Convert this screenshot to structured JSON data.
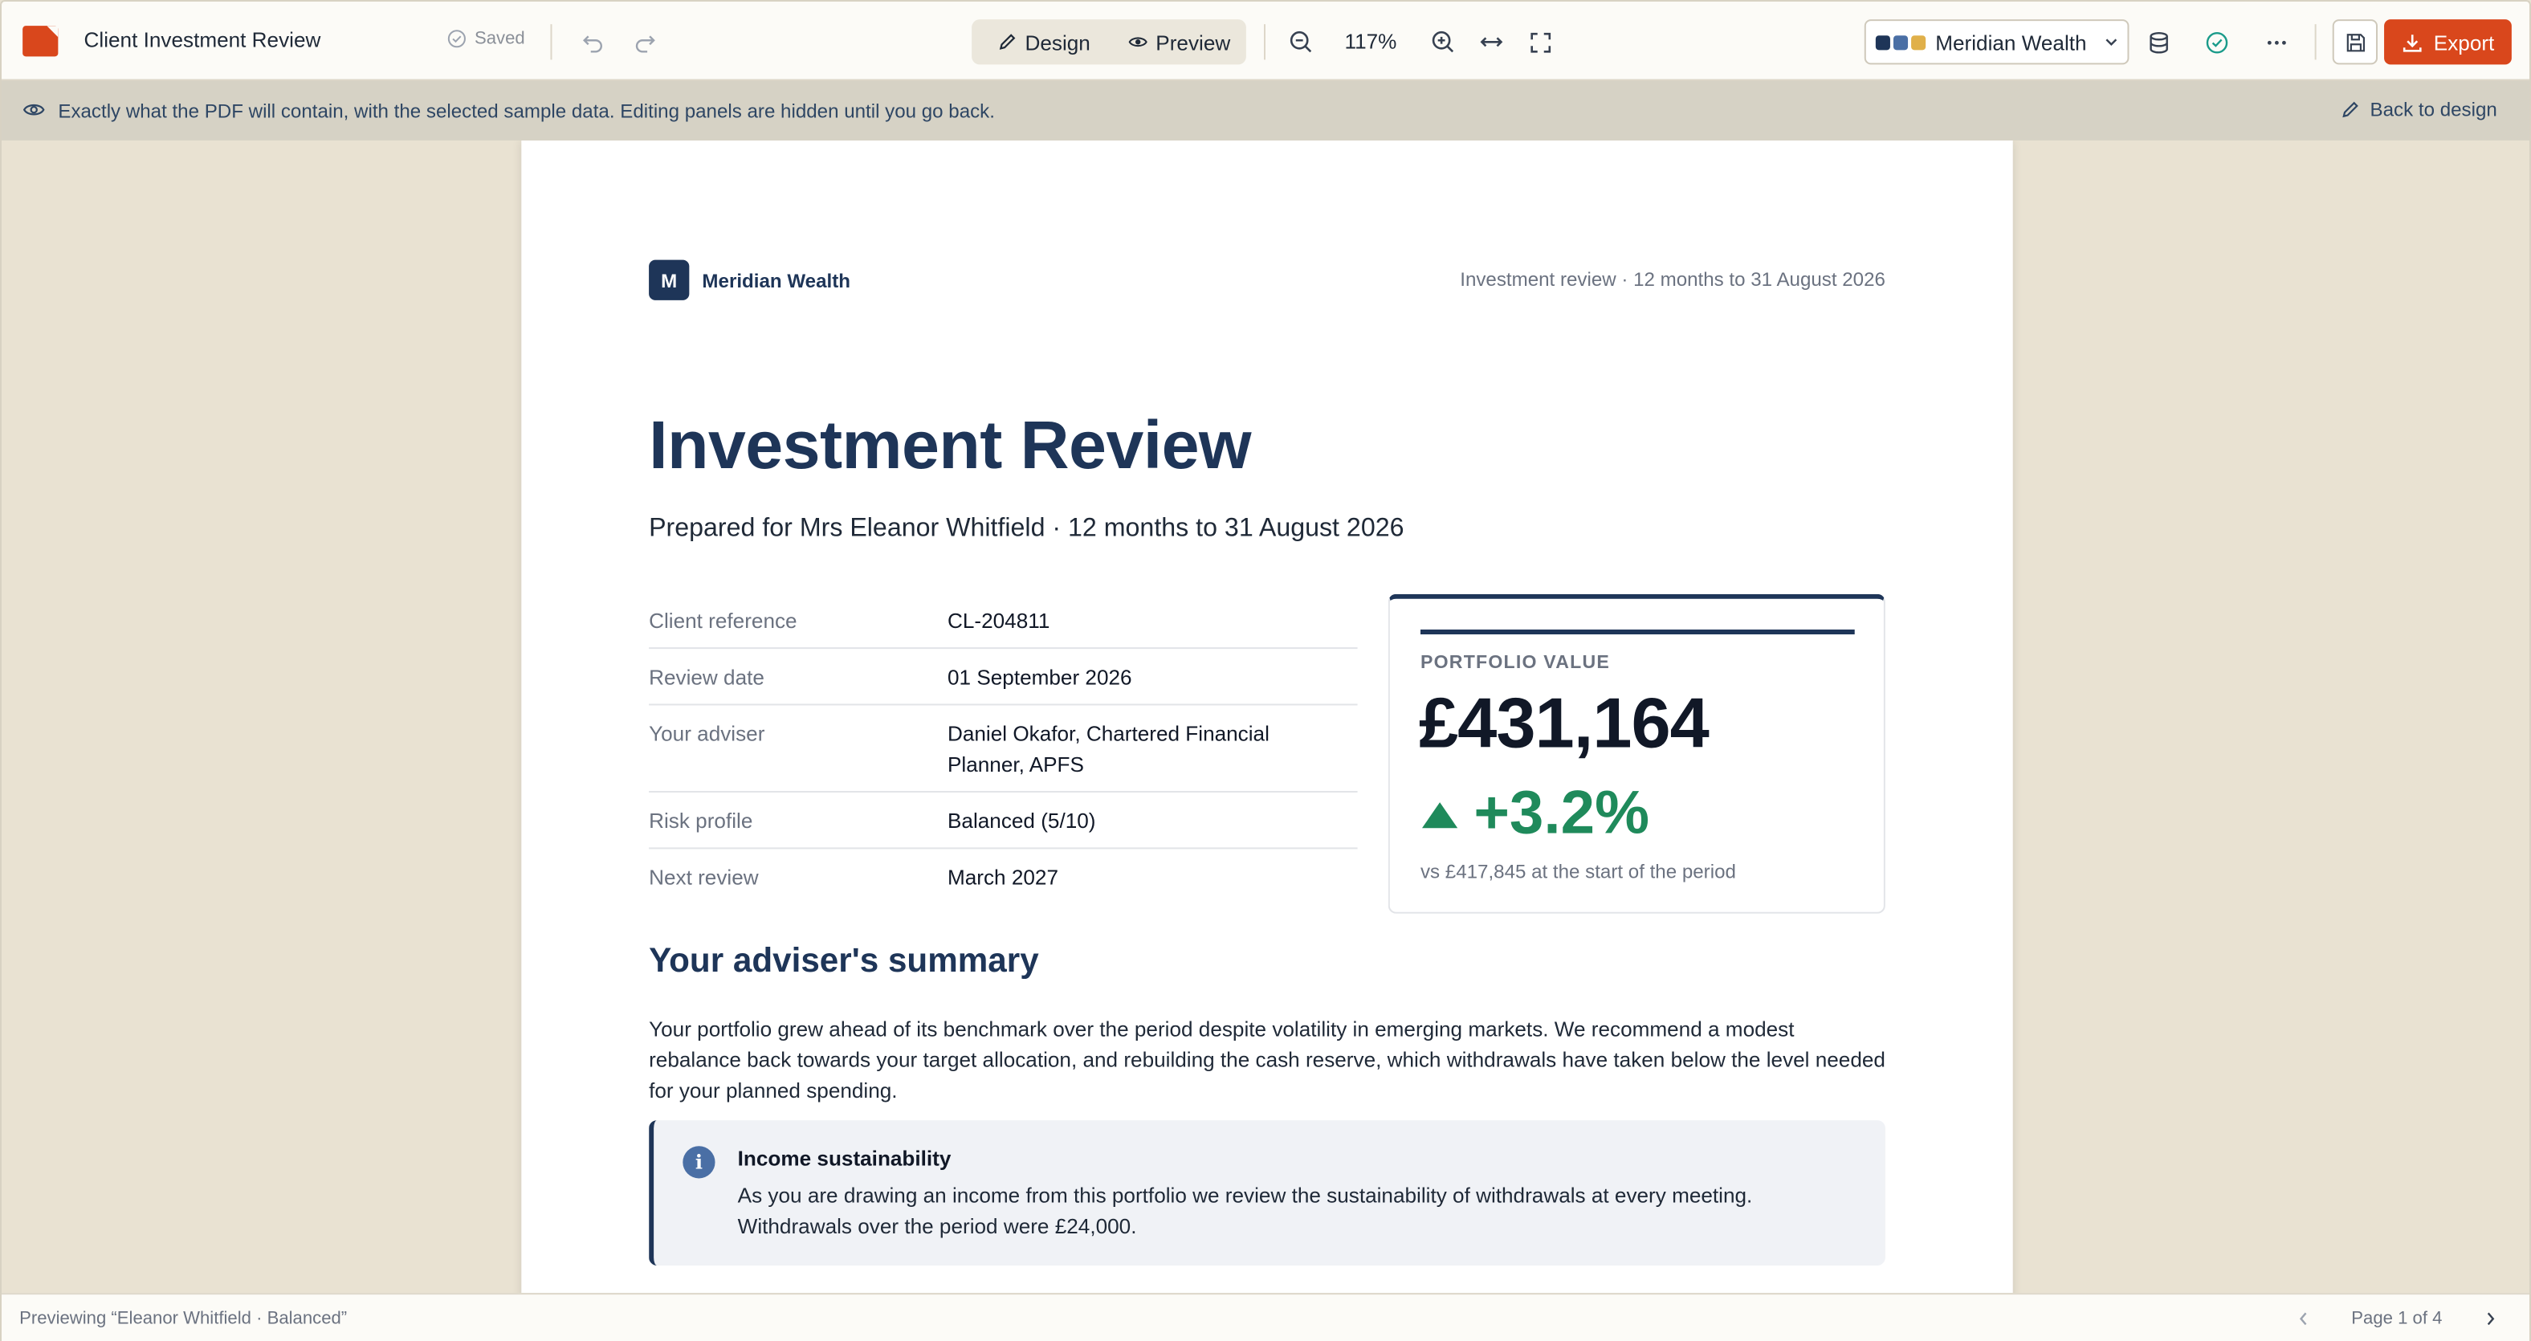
{
  "colors": {
    "brand_navy": "#1e3558",
    "accent_orange": "#d9471c",
    "positive_green": "#1f8a5b",
    "info_blue": "#4a6fa5",
    "swatch_1": "#1e3558",
    "swatch_2": "#4a6fa5",
    "swatch_3": "#e0b04a",
    "saved_check": "#1a9b8a"
  },
  "toolbar": {
    "doc_title": "Client Investment Review",
    "saved_label": "Saved",
    "design_label": "Design",
    "preview_label": "Preview",
    "zoom_level": "117%",
    "brand_select_label": "Meridian Wealth",
    "export_label": "Export"
  },
  "banner": {
    "text": "Exactly what the PDF will contain, with the selected sample data. Editing panels are hidden until you go back.",
    "back_label": "Back to design"
  },
  "document": {
    "brand_initial": "M",
    "brand_name": "Meridian Wealth",
    "header_right": "Investment review · 12 months to 31 August 2026",
    "title": "Investment Review",
    "subtitle": "Prepared for Mrs Eleanor Whitfield · 12 months to 31 August 2026",
    "facts": [
      {
        "label": "Client reference",
        "value": "CL-204811"
      },
      {
        "label": "Review date",
        "value": "01 September 2026"
      },
      {
        "label": "Your adviser",
        "value": "Daniel Okafor, Chartered Financial Planner, APFS"
      },
      {
        "label": "Risk profile",
        "value": "Balanced (5/10)"
      },
      {
        "label": "Next review",
        "value": "March 2027"
      }
    ],
    "portfolio": {
      "label": "PORTFOLIO VALUE",
      "amount": "£431,164",
      "change": "+3.2%",
      "note": "vs £417,845 at the start of the period"
    },
    "summary_heading": "Your adviser's summary",
    "summary_text": "Your portfolio grew ahead of its benchmark over the period despite volatility in emerging markets. We recommend a modest rebalance back towards your target allocation, and rebuilding the cash reserve, which withdrawals have taken below the level needed for your planned spending.",
    "callout": {
      "icon_letter": "i",
      "title": "Income sustainability",
      "text": "As you are drawing an income from this portfolio we review the sustainability of withdrawals at every meeting. Withdrawals over the period were £24,000."
    }
  },
  "statusbar": {
    "previewing": "Previewing “Eleanor Whitfield · Balanced”",
    "page_indicator": "Page 1 of 4"
  }
}
